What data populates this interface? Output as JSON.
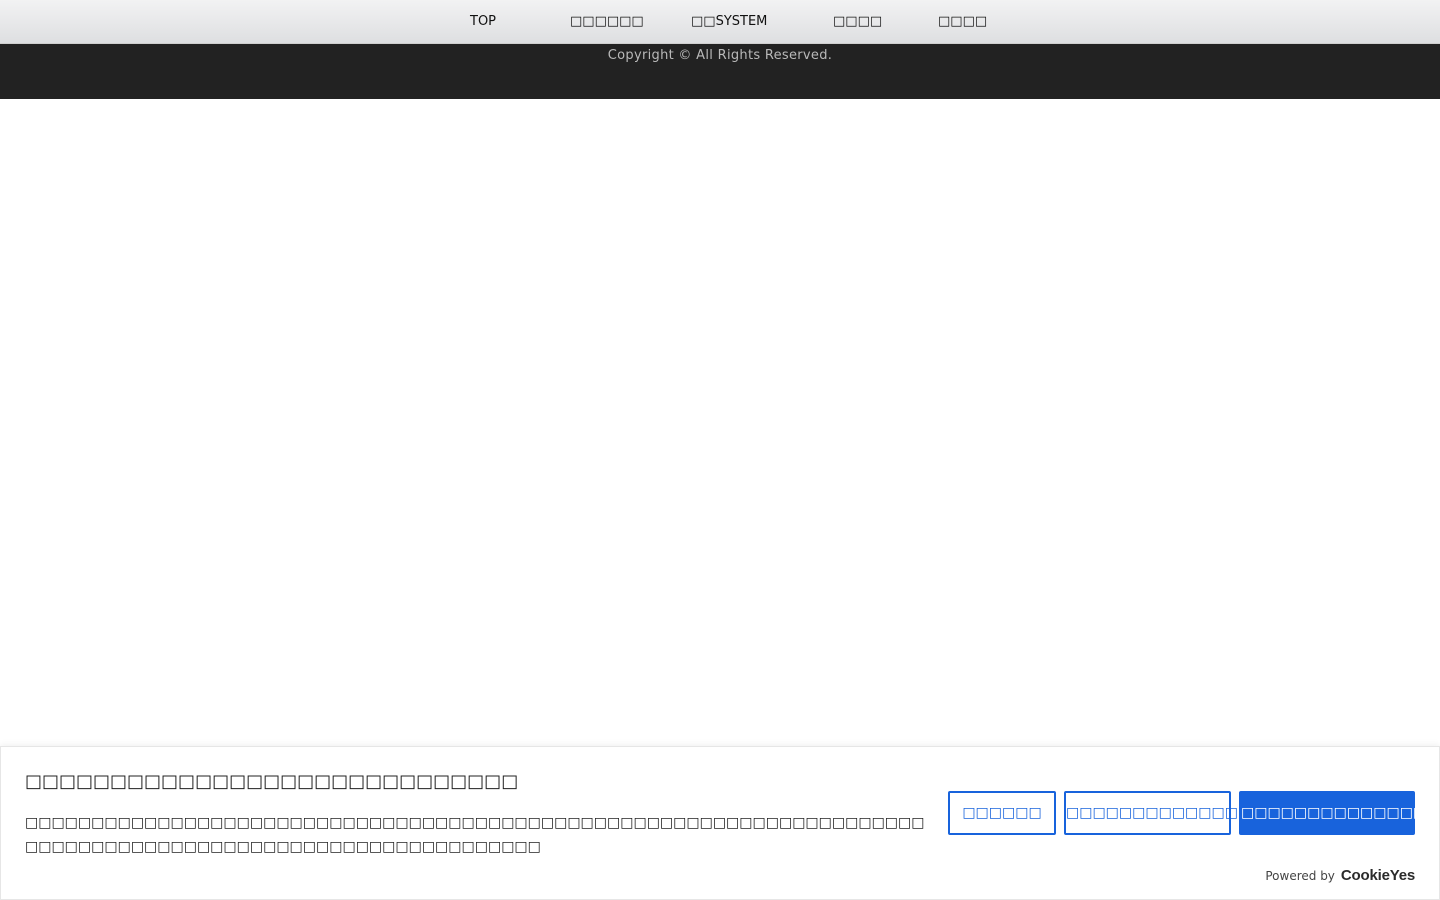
{
  "nav": {
    "items": [
      {
        "label": "TOP"
      },
      {
        "label": "□□□□□□"
      },
      {
        "label": "□□SYSTEM"
      },
      {
        "label": "□□□□"
      },
      {
        "label": "□□□□"
      }
    ]
  },
  "footer": {
    "copyright": "Copyright © All Rights Reserved."
  },
  "cookie_banner": {
    "title": "□□□□□□□□□□□□□□□□□□□□□□□□□□□□□",
    "description": "□□□□□□□□□□□□□□□□□□□□□□□□□□□□□□□□□□□□□□□□□□□□□□□□□□□□□□□□□□□□□□□□□□□□□□□□□□□□□□□□□□□□□□□□□□□□□□□□□□□□□□□□□□□",
    "buttons": {
      "reject": "□□□□□□",
      "customize": "□□□□□□□□□□□□□",
      "accept": "□□□□□□□□□□□□□□□"
    },
    "powered_by": "Powered by",
    "brand": "CookieYes",
    "colors": {
      "accent": "#1863dc"
    }
  }
}
